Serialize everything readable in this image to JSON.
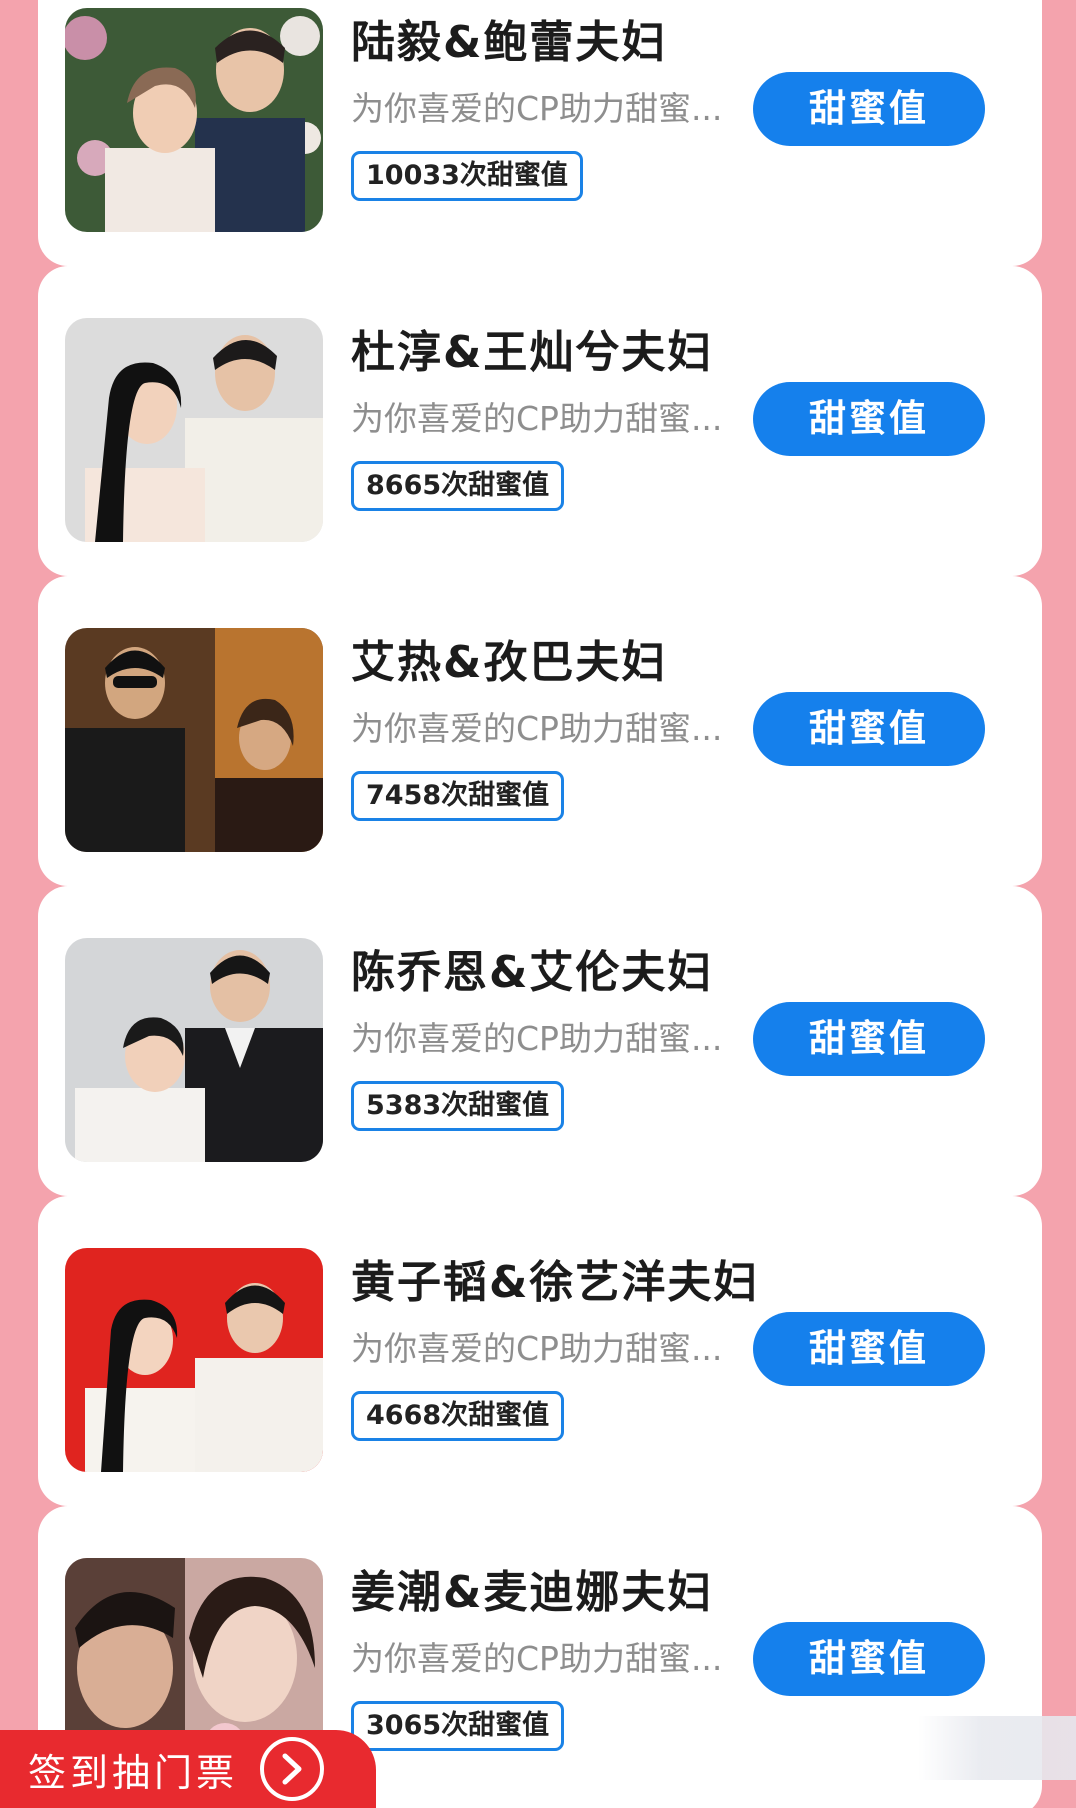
{
  "couples": [
    {
      "name": "陆毅&鲍蕾夫妇",
      "desc": "为你喜爱的CP助力甜蜜...",
      "count": "10033次甜蜜值",
      "button": "甜蜜值"
    },
    {
      "name": "杜淳&王灿兮夫妇",
      "desc": "为你喜爱的CP助力甜蜜...",
      "count": "8665次甜蜜值",
      "button": "甜蜜值"
    },
    {
      "name": "艾热&孜巴夫妇",
      "desc": "为你喜爱的CP助力甜蜜...",
      "count": "7458次甜蜜值",
      "button": "甜蜜值"
    },
    {
      "name": "陈乔恩&艾伦夫妇",
      "desc": "为你喜爱的CP助力甜蜜...",
      "count": "5383次甜蜜值",
      "button": "甜蜜值"
    },
    {
      "name": "黄子韬&徐艺洋夫妇",
      "desc": "为你喜爱的CP助力甜蜜...",
      "count": "4668次甜蜜值",
      "button": "甜蜜值"
    },
    {
      "name": "姜潮&麦迪娜夫妇",
      "desc": "为你喜爱的CP助力甜蜜...",
      "count": "3065次甜蜜值",
      "button": "甜蜜值"
    }
  ],
  "checkin": {
    "label": "签到抽门票",
    "icon": "chevron-right-circle-icon"
  },
  "colors": {
    "background": "#f4a3ad",
    "button": "#1580ec",
    "badge_border": "#1a82e6",
    "checkin": "#e82a2f"
  }
}
